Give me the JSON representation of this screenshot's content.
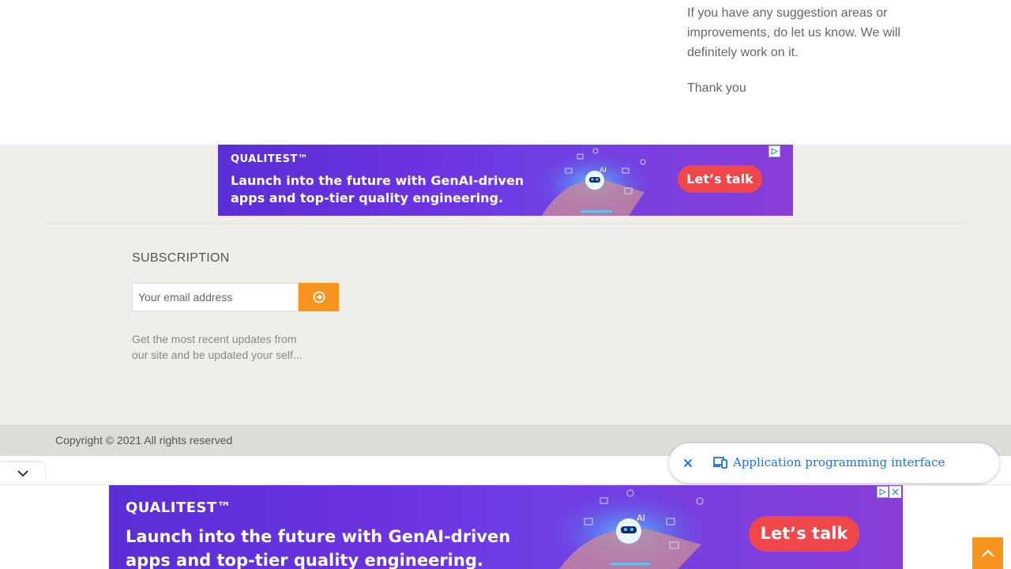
{
  "article": {
    "paragraph1": "If you have any suggestion areas or improvements, do let us know. We will definitely work on it.",
    "paragraph2": "Thank you"
  },
  "ads": {
    "brand": "QUALITEST™",
    "headline_line1": "Launch into the future with GenAI-driven",
    "headline_line2": "apps and top-tier quality engineering.",
    "cta": "Let’s talk"
  },
  "subscription": {
    "title": "SUBSCRIPTION",
    "email_placeholder": "Your email address",
    "note": "Get the most recent updates from our site and be updated your self..."
  },
  "footer": {
    "copyright": "Copyright © 2021 All rights reserved"
  },
  "api_suggestion": {
    "label": "Application programming interface"
  },
  "colors": {
    "accent_orange": "#f7941d",
    "footer_bg": "#efeee9",
    "copyright_bg": "#dcdcd8",
    "ad_cta": "#f0474b",
    "link_blue": "#1a73e8"
  },
  "icons": {
    "subscribe": "arrow-circle-right-icon",
    "collapse": "chevron-down-icon",
    "api": "devices-icon",
    "close": "close-icon",
    "scroll_top": "chevron-up-icon",
    "ad_choices": "ad-choices-icon"
  }
}
